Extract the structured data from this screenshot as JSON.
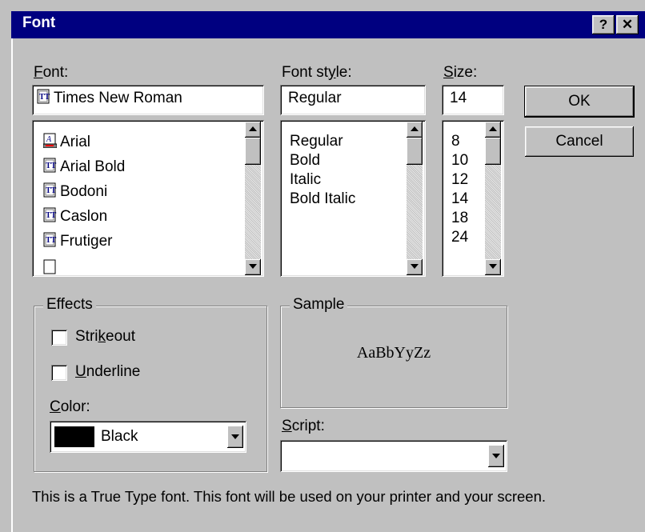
{
  "window": {
    "title": "Font",
    "help_label": "?",
    "close_label": "✕"
  },
  "font": {
    "label_key": "F",
    "label_rest": "ont:",
    "value": "Times New Roman",
    "list": [
      {
        "name": "Arial",
        "icon": "printer-font-icon"
      },
      {
        "name": "Arial Bold",
        "icon": "truetype-icon"
      },
      {
        "name": "Bodoni",
        "icon": "truetype-icon"
      },
      {
        "name": "Caslon",
        "icon": "truetype-icon"
      },
      {
        "name": "Frutiger",
        "icon": "truetype-icon"
      }
    ]
  },
  "style": {
    "label_pre": "Font st",
    "label_key": "y",
    "label_post": "le:",
    "value": "Regular",
    "list": [
      "Regular",
      "Bold",
      "Italic",
      "Bold Italic"
    ]
  },
  "size": {
    "label_key": "S",
    "label_rest": "ize:",
    "value": "14",
    "list": [
      "8",
      "10",
      "12",
      "14",
      "18",
      "24"
    ]
  },
  "buttons": {
    "ok": "OK",
    "cancel": "Cancel"
  },
  "effects": {
    "title": "Effects",
    "strikeout_pre": "Stri",
    "strikeout_key": "k",
    "strikeout_post": "eout",
    "strikeout_checked": false,
    "underline_key": "U",
    "underline_rest": "nderline",
    "underline_checked": false,
    "color_key": "C",
    "color_rest": "olor:",
    "color_value": "Black",
    "color_swatch": "#000000"
  },
  "sample": {
    "title": "Sample",
    "text": "AaBbYyZz"
  },
  "script": {
    "label_key": "S",
    "label_rest": "cript:",
    "value": ""
  },
  "footer_text": "This is a True Type font. This font will be used on your printer and your screen.",
  "colors": {
    "titlebar": "#000080",
    "face": "#c0c0c0"
  }
}
